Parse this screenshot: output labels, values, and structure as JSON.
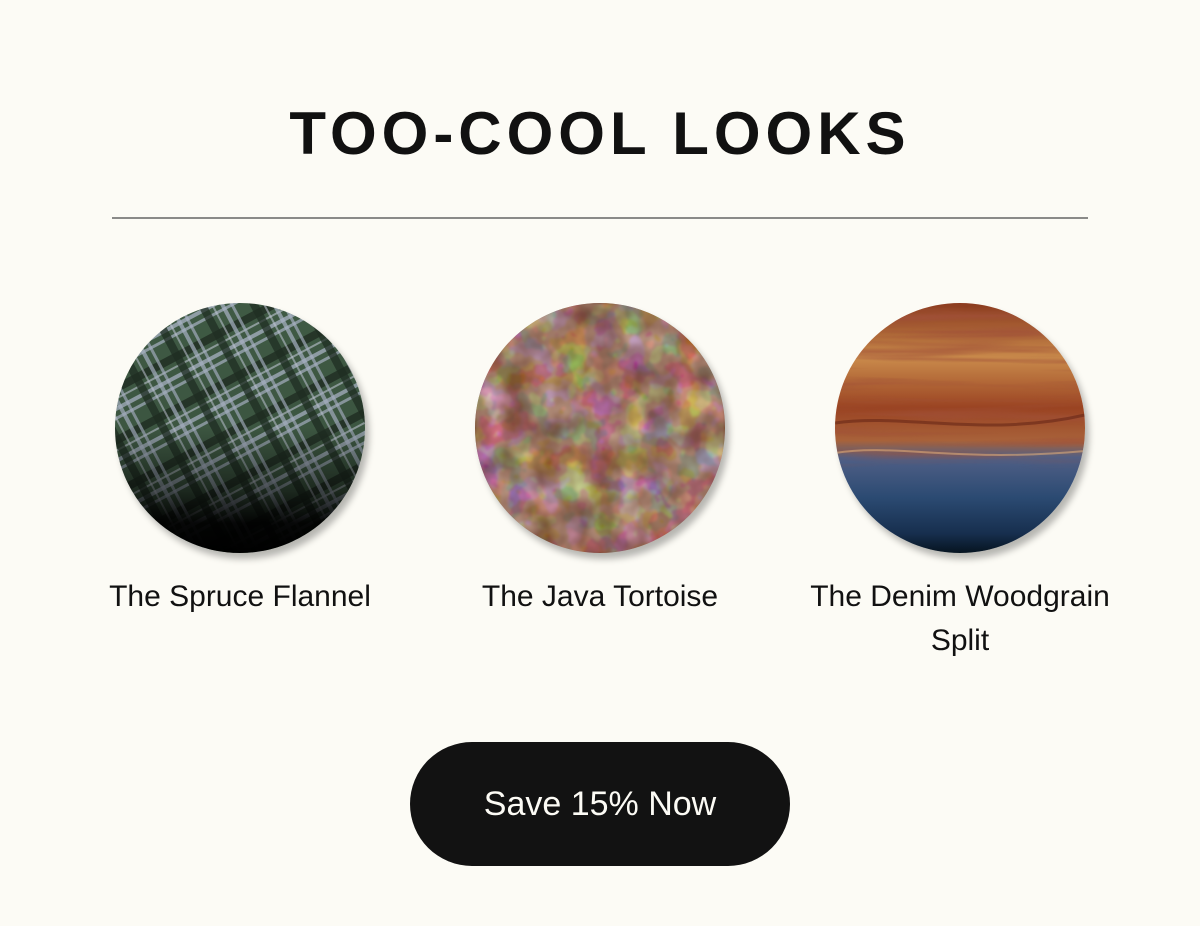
{
  "section": {
    "title": "TOO-COOL LOOKS"
  },
  "products": [
    {
      "name": "The Spruce Flannel",
      "swatch_icon": "plaid-flannel-swatch",
      "colors": [
        "#3f5a44",
        "#0a0c0a",
        "#c2c8d6"
      ]
    },
    {
      "name": "The Java Tortoise",
      "swatch_icon": "tortoiseshell-swatch",
      "colors": [
        "#e7c4b1",
        "#5a3222",
        "#100806"
      ]
    },
    {
      "name": "The Denim Woodgrain Split",
      "swatch_icon": "woodgrain-denim-swatch",
      "colors": [
        "#c98a4b",
        "#6f2016",
        "#2b4a72"
      ]
    }
  ],
  "cta": {
    "label": "Save 15% Now"
  },
  "colors": {
    "background": "#fcfbf5",
    "text": "#111111",
    "button_bg": "#121212",
    "button_text": "#fcfbf5",
    "divider": "#8a8a88"
  }
}
